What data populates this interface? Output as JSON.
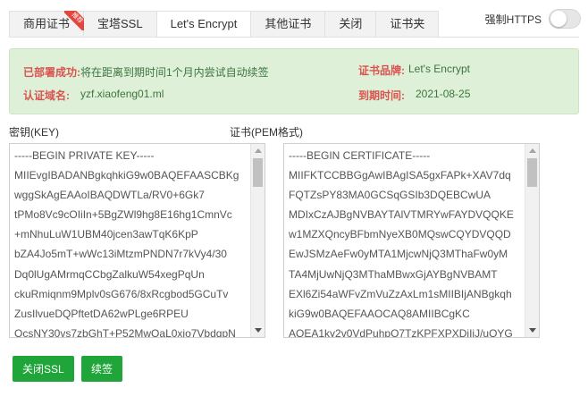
{
  "tabs": [
    {
      "label": "商用证书",
      "badge": "推荐",
      "active": false
    },
    {
      "label": "宝塔SSL",
      "active": false
    },
    {
      "label": "Let's Encrypt",
      "active": true
    },
    {
      "label": "其他证书",
      "active": false
    },
    {
      "label": "关闭",
      "active": false
    },
    {
      "label": "证书夹",
      "active": false
    }
  ],
  "force_https": {
    "label": "强制HTTPS",
    "enabled": false
  },
  "status": {
    "deployed_key": "已部署成功:",
    "deployed_val": "将在距离到期时间1个月内尝试自动续签",
    "domain_key": "认证域名:",
    "domain_val": "yzf.xiaofeng01.ml",
    "brand_key": "证书品牌:",
    "brand_val": "Let's Encrypt",
    "expiry_key": "到期时间:",
    "expiry_val": "2021-08-25"
  },
  "key_section": {
    "label": "密钥(KEY)",
    "lines": [
      "-----BEGIN PRIVATE KEY-----",
      "MIIEvgIBADANBgkqhkiG9w0BAQEFAASCBKg",
      "wggSkAgEAAoIBAQDWTLa/RV0+6Gk7",
      "tPMo8Vc9cOIiIn+5BgZWl9hg8E16hg1CmnVc",
      "+mNhuLuW1UBM40jcen3awTqK6KpP",
      "bZA4Jo5mT+wWc13iMtzmPNDN7r7kVy4/30",
      "Dq0lUgAMrmqCCbgZalkuW54xegPqUn",
      "ckuRmiqnm9Mplv0sG676/8xRcgbod5GCuTv",
      "ZusIlvueDQPftetDA62wPLge6RPEU",
      "OcsNY30vs7zbGhT+P52MwOaL0xio7VbdqpN"
    ]
  },
  "cert_section": {
    "label": "证书(PEM格式)",
    "lines": [
      "-----BEGIN CERTIFICATE-----",
      "MIIFKTCCBBGgAwIBAgISA5gxFAPk+XAV7dq",
      "FQTZsPY83MA0GCSqGSIb3DQEBCwUA",
      "MDIxCzAJBgNVBAYTAlVTMRYwFAYDVQQKE",
      "w1MZXQncyBFbmNyeXB0MQswCQYDVQQD",
      "EwJSMzAeFw0yMTA1MjcwNjQ3MThaFw0yM",
      "TA4MjUwNjQ3MThaMBwxGjAYBgNVBAMT",
      "EXl6Zi54aWFvZmVuZzAxLm1sMIIBIjANBgkqh",
      "kiG9w0BAQEFAAOCAQ8AMIIBCgKC",
      "AQEA1ky2v0VdPuhpO7TzKPFXPXDiIiJ/uQYG"
    ]
  },
  "buttons": {
    "close_ssl": "关闭SSL",
    "renew": "续签"
  },
  "colors": {
    "accent": "#20a53a",
    "status_key": "#d9534f",
    "status_val": "#3c763d",
    "panel_bg": "#dff0d8"
  }
}
